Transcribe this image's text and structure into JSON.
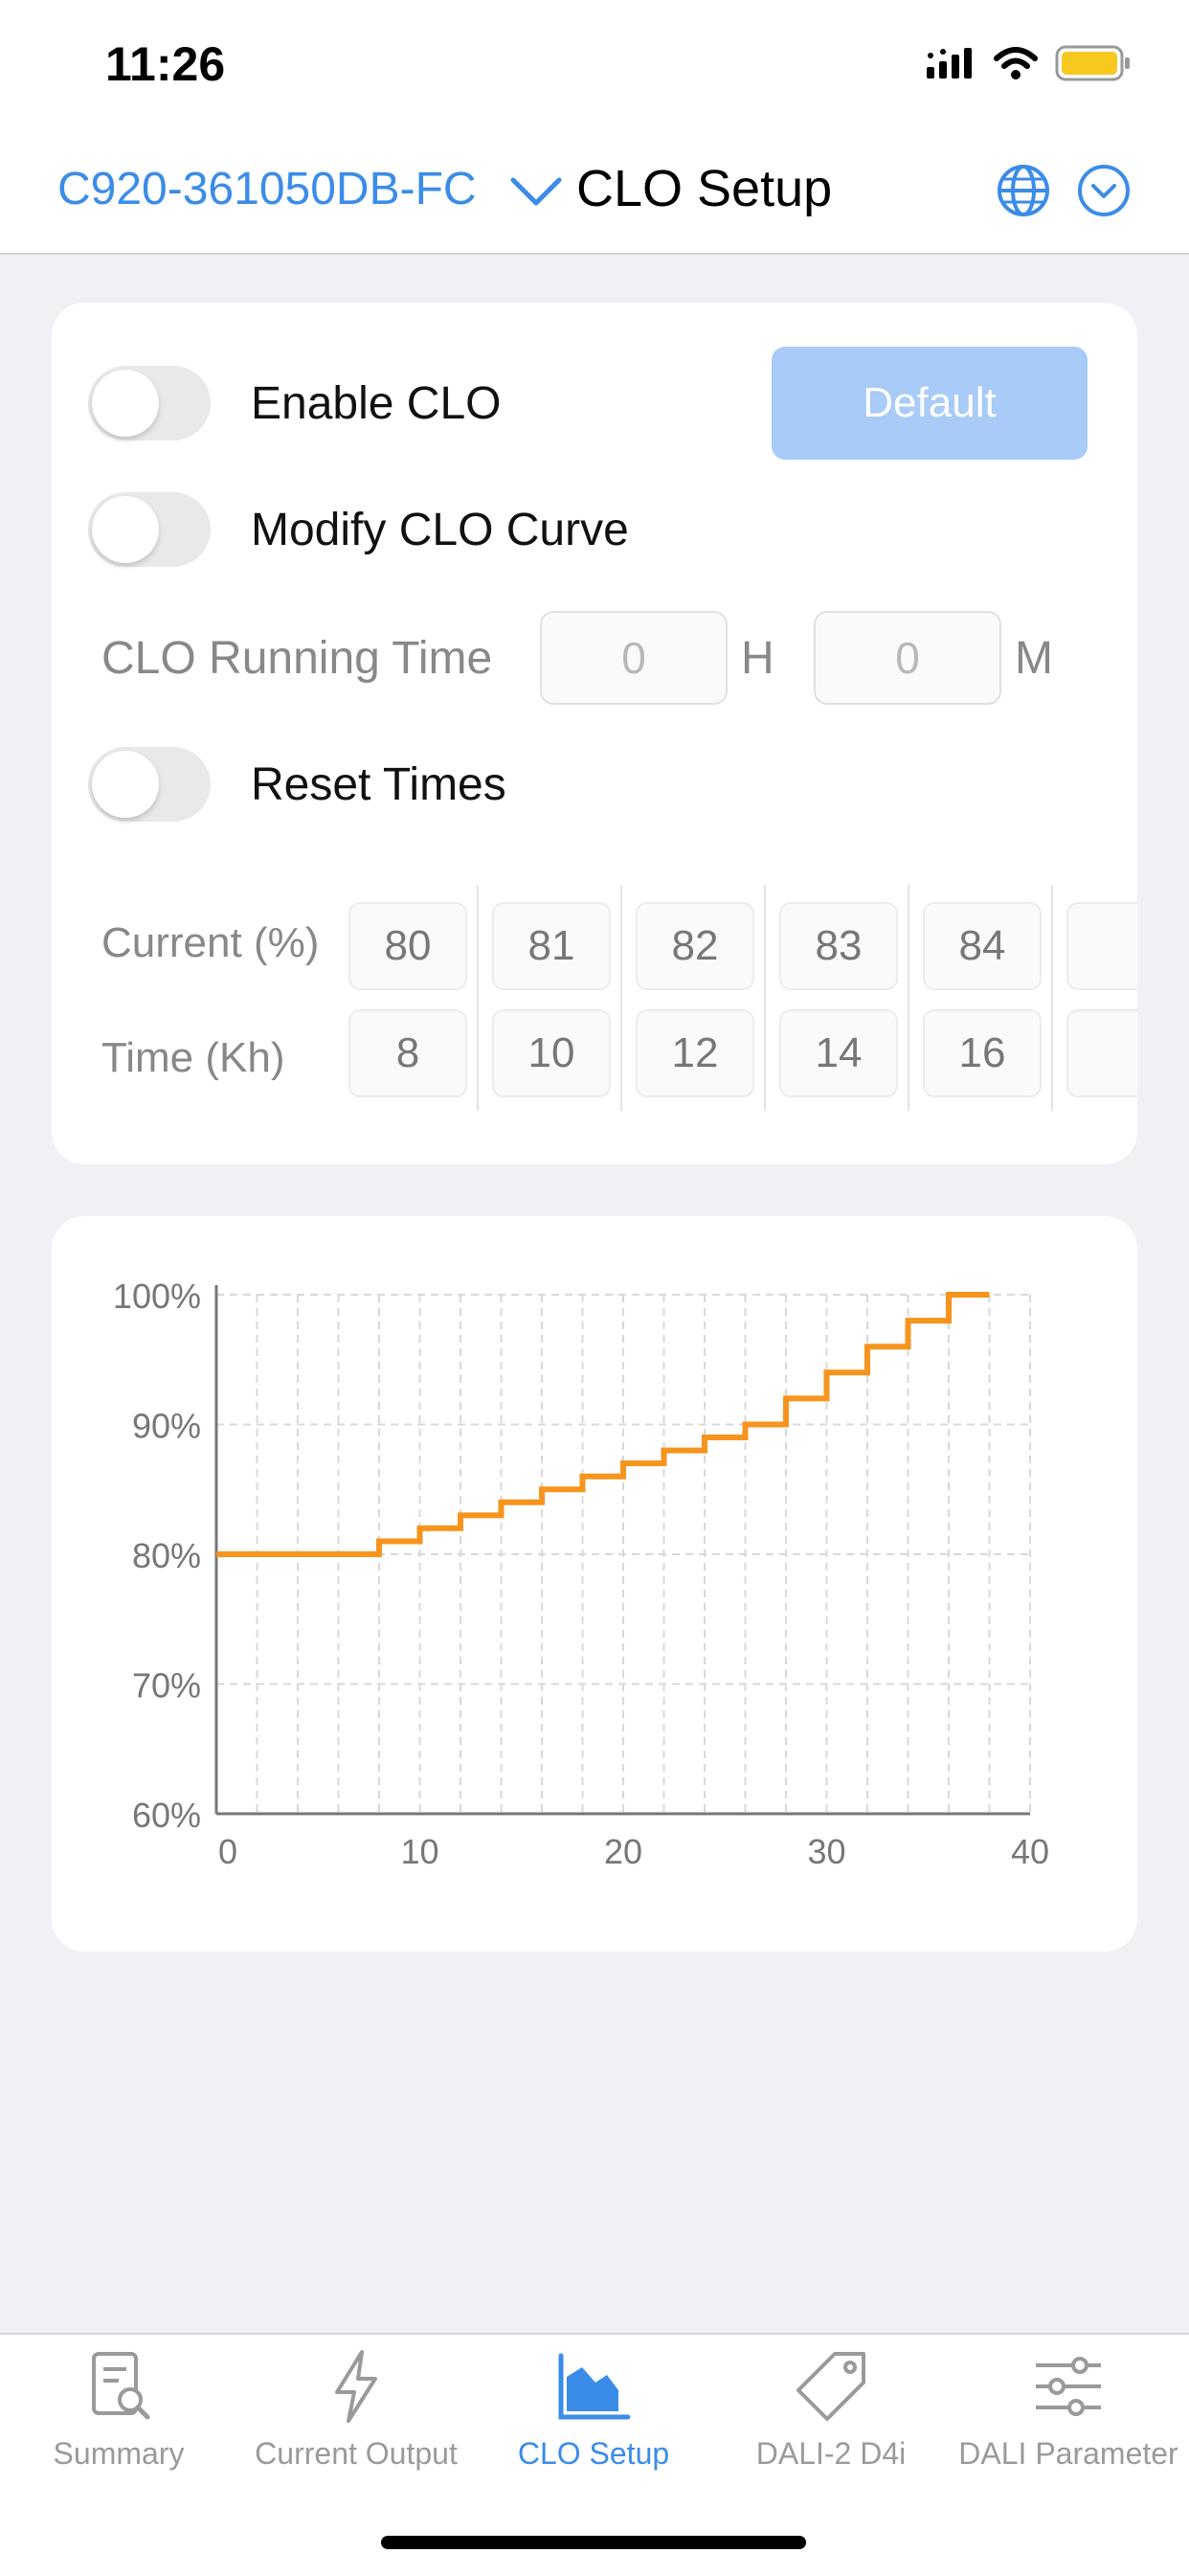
{
  "status_bar": {
    "time": "11:26"
  },
  "nav": {
    "device": "C920-361050DB-FC",
    "title": "CLO Setup"
  },
  "settings": {
    "enable_clo": {
      "label": "Enable CLO",
      "on": false
    },
    "modify_curve": {
      "label": "Modify CLO Curve",
      "on": false
    },
    "reset_times": {
      "label": "Reset Times",
      "on": false
    },
    "default_label": "Default",
    "running_time": {
      "label": "CLO Running Time",
      "hours": "0",
      "hours_unit": "H",
      "minutes": "0",
      "minutes_unit": "M"
    }
  },
  "curve_table": {
    "current_label": "Current (%)",
    "time_label": "Time (Kh)",
    "columns": [
      {
        "current": "80",
        "time": "8"
      },
      {
        "current": "81",
        "time": "10"
      },
      {
        "current": "82",
        "time": "12"
      },
      {
        "current": "83",
        "time": "14"
      },
      {
        "current": "84",
        "time": "16"
      }
    ]
  },
  "chart_data": {
    "type": "line",
    "x": [
      0,
      8,
      8,
      10,
      10,
      12,
      12,
      14,
      14,
      16,
      16,
      18,
      18,
      20,
      20,
      22,
      22,
      24,
      24,
      26,
      26,
      28,
      28,
      30,
      30,
      32,
      32,
      34,
      34,
      36,
      36,
      38
    ],
    "y": [
      80,
      80,
      81,
      81,
      82,
      82,
      83,
      83,
      84,
      84,
      85,
      85,
      86,
      86,
      87,
      87,
      88,
      88,
      89,
      89,
      90,
      90,
      92,
      92,
      94,
      94,
      96,
      96,
      98,
      98,
      100,
      100
    ],
    "xlim": [
      0,
      40
    ],
    "ylim": [
      60,
      100
    ],
    "x_ticks": [
      "0",
      "10",
      "20",
      "30",
      "40"
    ],
    "y_ticks": [
      "60%",
      "70%",
      "80%",
      "90%",
      "100%"
    ],
    "grid": true,
    "line_color": "#f7941d"
  },
  "tabs": [
    {
      "label": "Summary",
      "icon": "document-search-icon",
      "active": false
    },
    {
      "label": "Current Output",
      "icon": "lightning-icon",
      "active": false
    },
    {
      "label": "CLO Setup",
      "icon": "chart-trend-icon",
      "active": true
    },
    {
      "label": "DALI-2 D4i",
      "icon": "tag-icon",
      "active": false
    },
    {
      "label": "DALI Parameter",
      "icon": "sliders-icon",
      "active": false
    }
  ],
  "colors": {
    "accent": "#3b8ce8",
    "default_button": "#a8cbf7",
    "curve": "#f7941d"
  }
}
